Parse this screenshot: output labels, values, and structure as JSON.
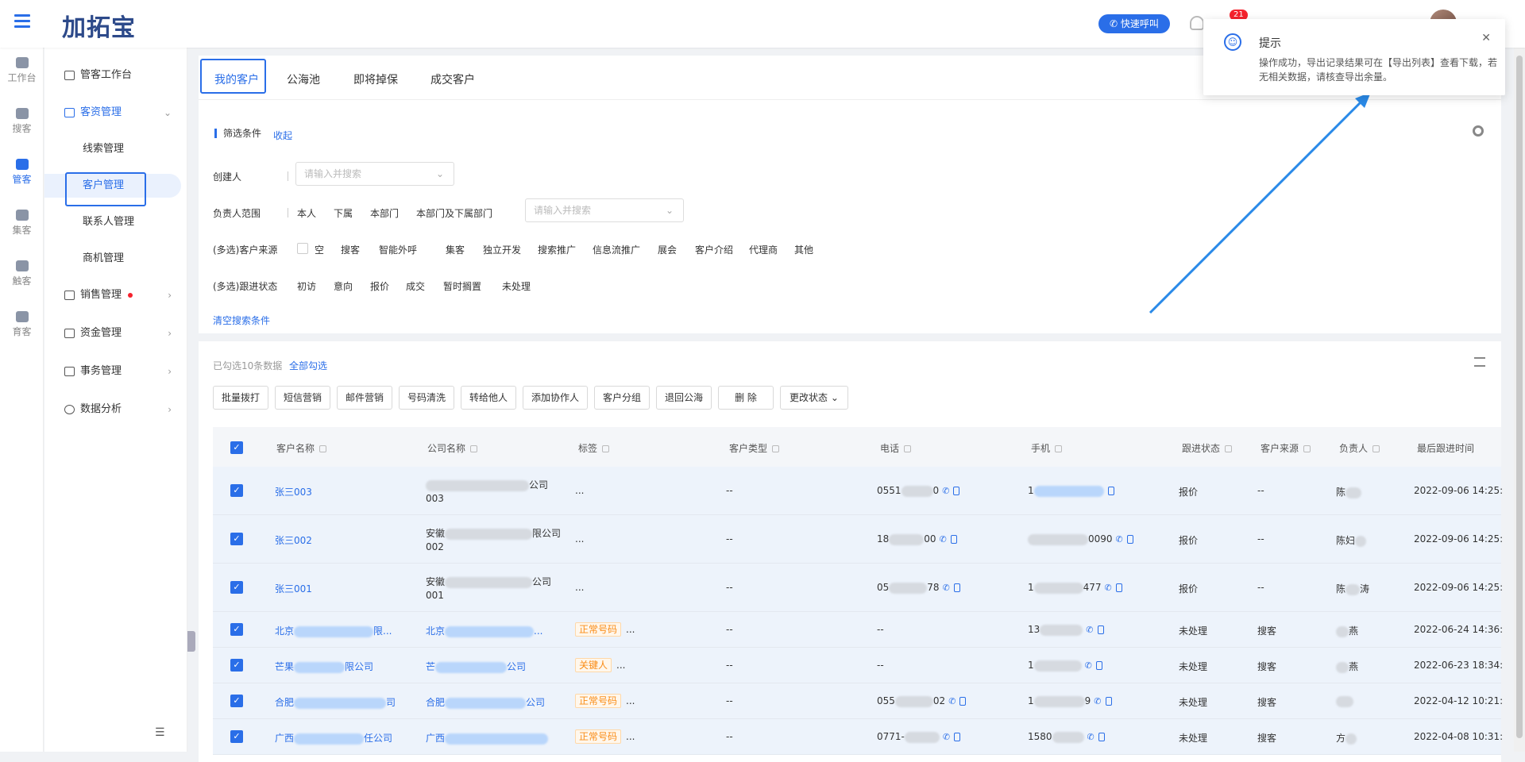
{
  "header": {
    "logo": "加拓宝",
    "quick_call": "快速呼叫",
    "badge": "21"
  },
  "rail": [
    {
      "label": "工作台",
      "icon": "desktop-icon"
    },
    {
      "label": "搜客",
      "icon": "search-user-icon"
    },
    {
      "label": "管客",
      "icon": "crm-cloud-icon",
      "active": true
    },
    {
      "label": "集客",
      "icon": "group-icon"
    },
    {
      "label": "触客",
      "icon": "headset-icon"
    },
    {
      "label": "育客",
      "icon": "user-grow-icon"
    }
  ],
  "sidebar": {
    "workbench": "管客工作台",
    "customer_mgmt": "客资管理",
    "subs": [
      "线索管理",
      "客户管理",
      "联系人管理",
      "商机管理"
    ],
    "sales": "销售管理",
    "finance": "资金管理",
    "affairs": "事务管理",
    "analysis": "数据分析"
  },
  "tabs": [
    "我的客户",
    "公海池",
    "即将掉保",
    "成交客户"
  ],
  "filter": {
    "title": "筛选条件",
    "collapse": "收起",
    "creator_label": "创建人",
    "creator_placeholder": "请输入并搜索",
    "owner_label": "负责人范围",
    "owner_opts": [
      "本人",
      "下属",
      "本部门",
      "本部门及下属部门"
    ],
    "owner_placeholder": "请输入并搜索",
    "source_label": "(多选)客户来源",
    "source_opts": [
      "空",
      "搜客",
      "智能外呼",
      "集客",
      "独立开发",
      "搜索推广",
      "信息流推广",
      "展会",
      "客户介绍",
      "代理商",
      "其他"
    ],
    "status_label": "(多选)跟进状态",
    "status_opts": [
      "初访",
      "意向",
      "报价",
      "成交",
      "暂时搁置",
      "未处理"
    ],
    "clear": "清空搜索条件"
  },
  "list": {
    "selected_info": "已勾选10条数据",
    "select_all": "全部勾选",
    "buttons": [
      "批量拨打",
      "短信营销",
      "邮件营销",
      "号码清洗",
      "转给他人",
      "添加协作人",
      "客户分组",
      "退回公海",
      "删 除",
      "更改状态"
    ],
    "columns": [
      "客户名称",
      "公司名称",
      "标签",
      "客户类型",
      "电话",
      "手机",
      "跟进状态",
      "客户来源",
      "负责人",
      "最后跟进时间"
    ],
    "rows": [
      {
        "name": "张三003",
        "company_a": "",
        "company_b": "公司",
        "company_c": "003",
        "tag": "...",
        "type": "--",
        "tel": "0551",
        "tel_end": "0",
        "mob": "1",
        "status": "报价",
        "source": "--",
        "owner": "陈",
        "time": "2022-09-06 14:25:"
      },
      {
        "name": "张三002",
        "company_a": "安徽",
        "company_b": "限公司",
        "company_c": "002",
        "tag": "...",
        "type": "--",
        "tel": "18",
        "tel_end": "00",
        "mob": "",
        "mob_end": "0090",
        "status": "报价",
        "source": "--",
        "owner": "陈妇",
        "time": "2022-09-06 14:25:"
      },
      {
        "name": "张三001",
        "company_a": "安徽",
        "company_b": "公司",
        "company_c": "001",
        "tag": "...",
        "type": "--",
        "tel": "05",
        "tel_end": "78",
        "mob": "1",
        "mob_end": "477",
        "status": "报价",
        "source": "--",
        "owner": "陈",
        "owner_end": "涛",
        "time": "2022-09-06 14:25:"
      },
      {
        "name": "北京",
        "name_end": "限...",
        "company_a": "北京",
        "company_b": "...",
        "tag": "正常号码",
        "type": "--",
        "tel": "--",
        "mob": "13",
        "status": "未处理",
        "source": "搜客",
        "owner": "燕",
        "time": "2022-06-24 14:36:"
      },
      {
        "name": "芒果",
        "name_end": "限公司",
        "company_a": "芒",
        "company_b": "公司",
        "tag": "关键人",
        "type": "--",
        "tel": "--",
        "mob": "1",
        "status": "未处理",
        "source": "搜客",
        "owner": "燕",
        "time": "2022-06-23 18:34:"
      },
      {
        "name": "合肥",
        "name_end": "司",
        "company_a": "合肥",
        "company_b": "公司",
        "tag": "正常号码",
        "type": "--",
        "tel": "055",
        "tel_end": "02",
        "mob": "1",
        "mob_end": "9",
        "status": "未处理",
        "source": "搜客",
        "owner": "",
        "time": "2022-04-12 10:21:"
      },
      {
        "name": "广西",
        "name_end": "任公司",
        "company_a": "广西",
        "company_b": "",
        "tag": "正常号码",
        "type": "--",
        "tel": "0771-",
        "mob": "1580",
        "status": "未处理",
        "source": "搜客",
        "owner": "方",
        "time": "2022-04-08 10:31:"
      }
    ]
  },
  "toast": {
    "title": "提示",
    "message": "操作成功，导出记录结果可在【导出列表】查看下载，若无相关数据，请核查导出余量。"
  },
  "colors": {
    "primary": "#2a6ee8",
    "tag_orange": "#fa8c16"
  }
}
